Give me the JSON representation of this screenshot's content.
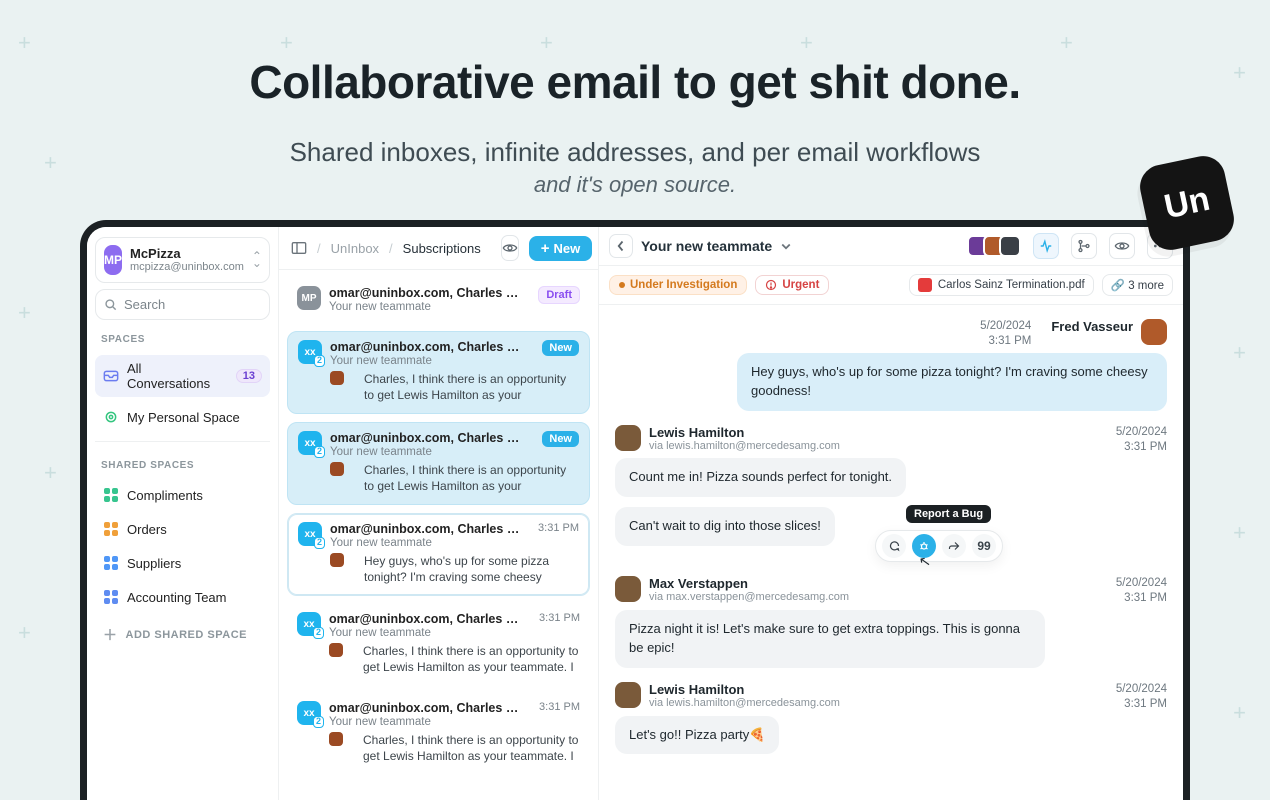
{
  "hero": {
    "title": "Collaborative email to get shit done.",
    "subtitle": "Shared inboxes, infinite addresses, and per email workflows",
    "tagline": "and it's open source.",
    "badge": "Un"
  },
  "workspace": {
    "avatar": "MP",
    "name": "McPizza",
    "email": "mcpizza@uninbox.com"
  },
  "search_placeholder": "Search",
  "sections": {
    "spaces_label": "SPACES",
    "shared_label": "SHARED SPACES",
    "add_shared": "ADD SHARED SPACE"
  },
  "spaces": {
    "all": {
      "label": "All Conversations",
      "count": "13"
    },
    "personal": {
      "label": "My Personal Space"
    }
  },
  "shared_spaces": [
    {
      "label": "Compliments",
      "color": "#37c58f"
    },
    {
      "label": "Orders",
      "color": "#f0a03a"
    },
    {
      "label": "Suppliers",
      "color": "#4f97f7"
    },
    {
      "label": "Accounting Team",
      "color": "#5f8cf1"
    }
  ],
  "list_header": {
    "crumb1": "UnInbox",
    "crumb2": "Subscriptions",
    "new_label": "New"
  },
  "conversations": [
    {
      "avatar": "MP",
      "avatar_style": "gray",
      "addr": "omar@uninbox.com, Charles Leclerc,...",
      "subject": "Your new teammate",
      "preview": "",
      "tag": "draft",
      "tag_text": "Draft"
    },
    {
      "avatar": "xx",
      "avatar_style": "blue",
      "addr": "omar@uninbox.com, Charles Leclerc, Fr...",
      "subject": "Your new teammate",
      "preview": "Charles, I think there is an opportunity to get Lewis Hamilton as your teammate. I know how...",
      "tag": "new",
      "tag_text": "New",
      "selected": "blue"
    },
    {
      "avatar": "xx",
      "avatar_style": "blue",
      "addr": "omar@uninbox.com, Charles Leclerc, Fr...",
      "subject": "Your new teammate",
      "preview": "Charles, I think there is an opportunity to get Lewis Hamilton as your teammate. I know how...",
      "tag": "new",
      "tag_text": "New",
      "selected": "blue"
    },
    {
      "avatar": "xx",
      "avatar_style": "blue",
      "addr": "omar@uninbox.com, Charles Leclerc, Fr...",
      "subject": "Your new teammate",
      "preview": "Hey guys, who's up for some pizza tonight? I'm craving some cheesy goodness!",
      "tag": "time",
      "tag_text": "3:31 PM",
      "selected": "white"
    },
    {
      "avatar": "xx",
      "avatar_style": "blue",
      "addr": "omar@uninbox.com, Charles Leclerc, Fr...",
      "subject": "Your new teammate",
      "preview": "Charles, I think there is an opportunity to get Lewis Hamilton as your teammate. I know how...",
      "tag": "time",
      "tag_text": "3:31 PM"
    },
    {
      "avatar": "xx",
      "avatar_style": "blue",
      "addr": "omar@uninbox.com, Charles Leclerc, Fr...",
      "subject": "Your new teammate",
      "preview": "Charles, I think there is an opportunity to get Lewis Hamilton as your teammate. I know how...",
      "tag": "time",
      "tag_text": "3:31 PM"
    }
  ],
  "detail": {
    "title": "Your new teammate",
    "tag_investigation": "Under Investigation",
    "tag_urgent": "Urgent",
    "attachment": "Carlos Sainz Termination.pdf",
    "more_attachments": "3 more",
    "tooltip": "Report a Bug"
  },
  "messages": [
    {
      "side": "right",
      "name": "Fred Vasseur",
      "date": "5/20/2024",
      "time": "3:31 PM",
      "text": "Hey guys, who's up for some pizza tonight? I'm craving some cheesy goodness!"
    },
    {
      "side": "left",
      "name": "Lewis Hamilton",
      "via": "via lewis.hamilton@mercedesamg.com",
      "date": "5/20/2024",
      "time": "3:31 PM",
      "text": "Count me in! Pizza sounds perfect for tonight.",
      "text2": "Can't wait to dig into those slices!",
      "actions": true
    },
    {
      "side": "left",
      "name": "Max Verstappen",
      "via": "via max.verstappen@mercedesamg.com",
      "date": "5/20/2024",
      "time": "3:31 PM",
      "text": "Pizza night it is! Let's make sure to get extra toppings. This is gonna be epic!"
    },
    {
      "side": "left",
      "name": "Lewis Hamilton",
      "via": "via lewis.hamilton@mercedesamg.com",
      "date": "5/20/2024",
      "time": "3:31 PM",
      "text": "Let's go!! Pizza party🍕"
    }
  ]
}
